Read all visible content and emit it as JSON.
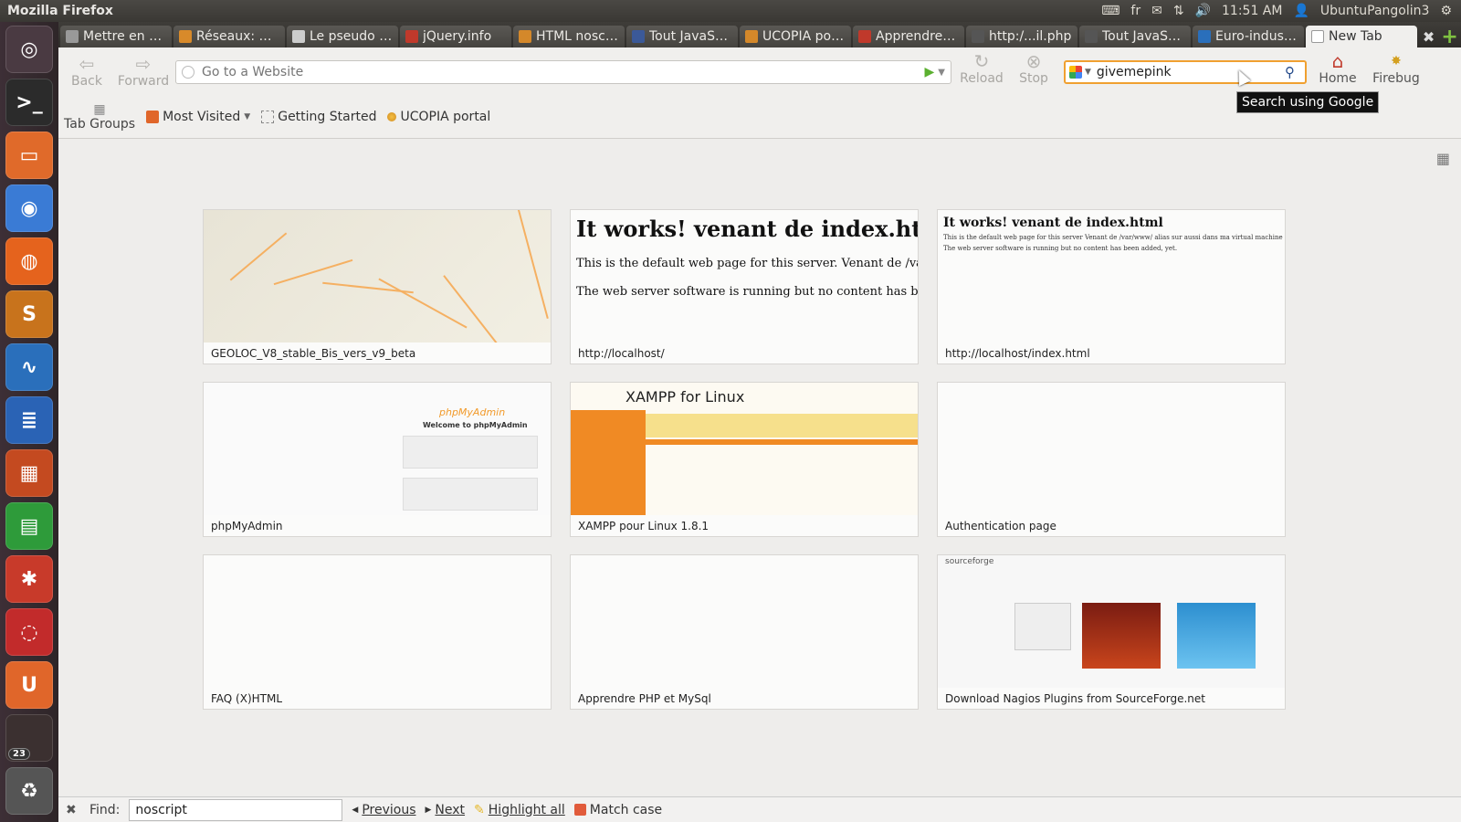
{
  "panel": {
    "title": "Mozilla Firefox",
    "keyboard_layout": "fr",
    "time": "11:51 AM",
    "user": "UbuntuPangolin3"
  },
  "launcher": {
    "items": [
      {
        "name": "ubuntu-dash",
        "glyph": "◎",
        "color": "#4a3a42"
      },
      {
        "name": "terminal",
        "glyph": ">_",
        "color": "#2b2b2b"
      },
      {
        "name": "files",
        "glyph": "▭",
        "color": "#e06a2a"
      },
      {
        "name": "chromium",
        "glyph": "◉",
        "color": "#3a7bd5"
      },
      {
        "name": "firefox",
        "glyph": "◍",
        "color": "#e5631d"
      },
      {
        "name": "sublime",
        "glyph": "S",
        "color": "#c8731c"
      },
      {
        "name": "monitor",
        "glyph": "∿",
        "color": "#2a6fbb"
      },
      {
        "name": "writer",
        "glyph": "≣",
        "color": "#2a63b5"
      },
      {
        "name": "impress",
        "glyph": "▦",
        "color": "#c44a20"
      },
      {
        "name": "calc",
        "glyph": "▤",
        "color": "#2e9b3a"
      },
      {
        "name": "settings",
        "glyph": "✱",
        "color": "#c83a2a"
      },
      {
        "name": "apps",
        "glyph": "◌",
        "color": "#c22b2b"
      },
      {
        "name": "software",
        "glyph": "U",
        "color": "#e0662a"
      },
      {
        "name": "workspaces",
        "glyph": "",
        "color": "#3b3030",
        "badge": "23"
      },
      {
        "name": "trash",
        "glyph": "♻",
        "color": "#555555"
      }
    ]
  },
  "tabs": [
    {
      "label": "Mettre en p...",
      "active": false
    },
    {
      "label": "Réseaux: Q...",
      "active": false
    },
    {
      "label": "Le pseudo - ...",
      "active": false
    },
    {
      "label": "jQuery.info",
      "active": false
    },
    {
      "label": "HTML noscr...",
      "active": false
    },
    {
      "label": "Tout JavaSc...",
      "active": false
    },
    {
      "label": "UCOPIA por...",
      "active": false
    },
    {
      "label": "Apprendre ...",
      "active": false
    },
    {
      "label": "http:/...il.php",
      "active": false
    },
    {
      "label": "Tout JavaSc...",
      "active": false
    },
    {
      "label": "Euro-indust...",
      "active": false
    },
    {
      "label": "New Tab",
      "active": true
    }
  ],
  "nav": {
    "back": "Back",
    "forward": "Forward",
    "url_placeholder": "Go to a Website",
    "reload": "Reload",
    "stop": "Stop",
    "search_value": "givemepink",
    "home": "Home",
    "firebug": "Firebug",
    "tooltip": "Search using Google"
  },
  "bookmarks": {
    "tab_groups": "Tab Groups",
    "items": [
      "Most Visited",
      "Getting Started",
      "UCOPIA portal"
    ]
  },
  "thumbnails": [
    {
      "title": "GEOLOC_V8_stable_Bis_vers_v9_beta",
      "preview": "map"
    },
    {
      "title": "http://localhost/",
      "preview": "works",
      "heading": "It works! venant de index.ht",
      "line1": "This is the default web page for this server. Venant de /var/ww",
      "line2": "The web server software is running but no content has been a"
    },
    {
      "title": "http://localhost/index.html",
      "preview": "works-small",
      "heading": "It works! venant de index.html",
      "line1": "This is the default web page for this server Venant de /var/www/ alias sur aussi dans ma virtual machine ubuntu",
      "line2": "The web server software is running but no content has been added, yet."
    },
    {
      "title": "phpMyAdmin",
      "preview": "pma",
      "brand": "phpMyAdmin",
      "welcome": "Welcome to phpMyAdmin"
    },
    {
      "title": "XAMPP pour Linux 1.8.1",
      "preview": "xampp",
      "brand": "XAMPP for Linux"
    },
    {
      "title": "Authentication page",
      "preview": "blank"
    },
    {
      "title": "FAQ (X)HTML",
      "preview": "blank"
    },
    {
      "title": "Apprendre PHP et MySql",
      "preview": "blank"
    },
    {
      "title": "Download Nagios Plugins from SourceForge.net",
      "preview": "sf",
      "brand": "sourceforge"
    }
  ],
  "findbar": {
    "label": "Find:",
    "value": "noscript",
    "previous": "Previous",
    "next": "Next",
    "highlight": "Highlight all",
    "match_case": "Match case"
  }
}
